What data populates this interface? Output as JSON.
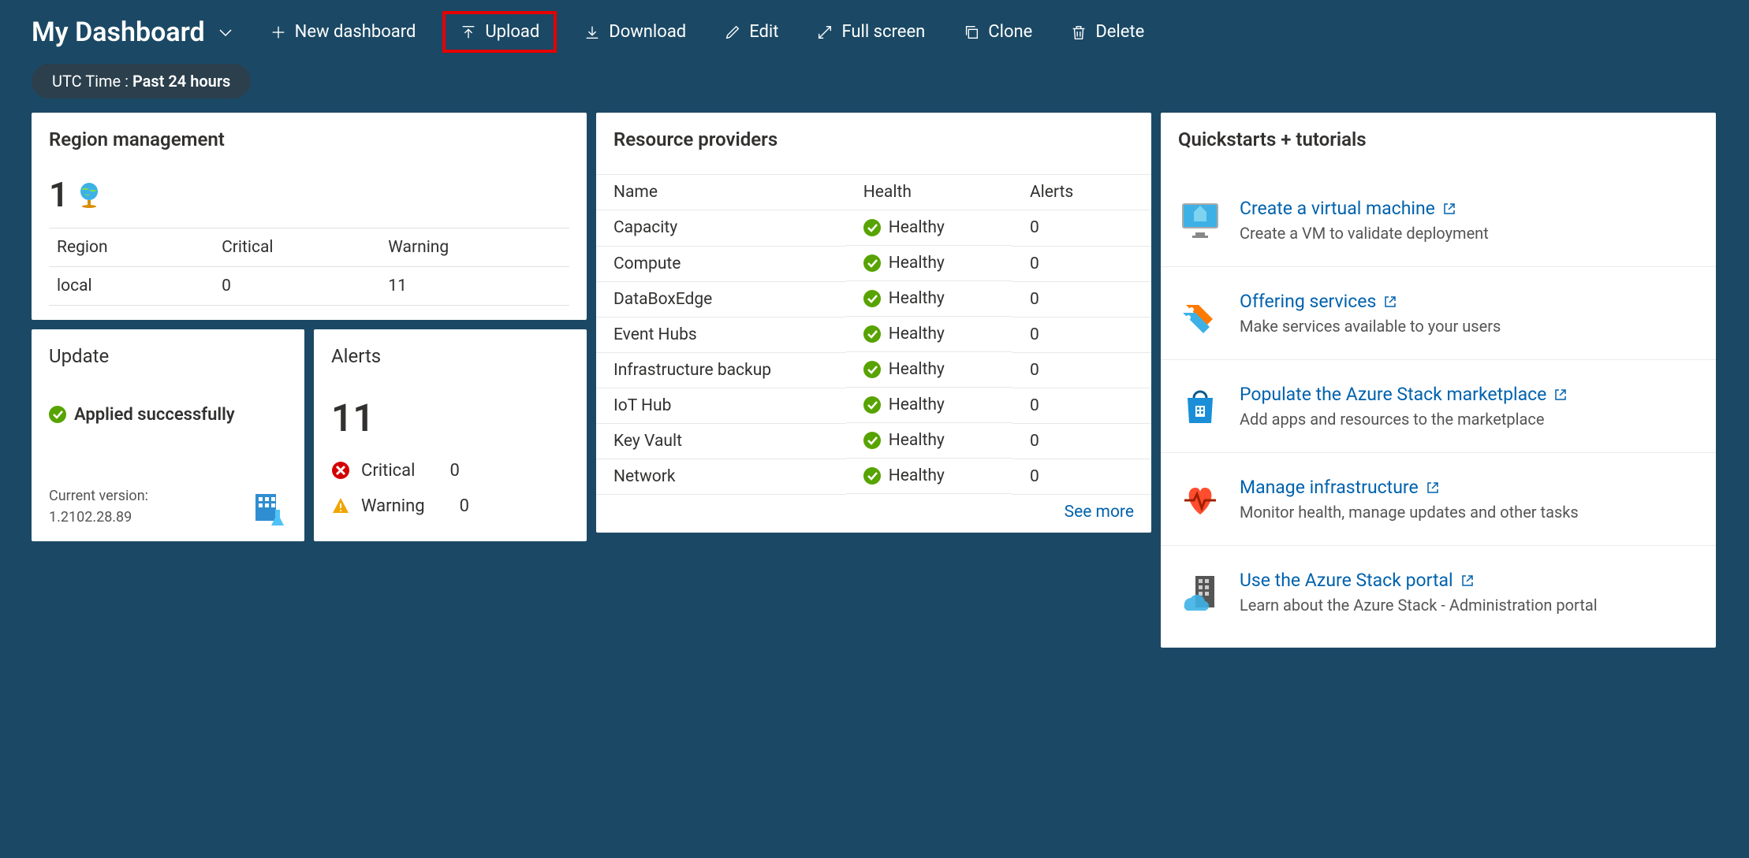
{
  "header": {
    "title": "My Dashboard",
    "buttons": {
      "new_dashboard": "New dashboard",
      "upload": "Upload",
      "download": "Download",
      "edit": "Edit",
      "full_screen": "Full screen",
      "clone": "Clone",
      "delete": "Delete"
    },
    "time_pill_prefix": "UTC Time : ",
    "time_pill_value": "Past 24 hours"
  },
  "region_mgmt": {
    "title": "Region management",
    "count": "1",
    "cols": {
      "region": "Region",
      "critical": "Critical",
      "warning": "Warning"
    },
    "rows": [
      {
        "region": "local",
        "critical": "0",
        "warning": "11"
      }
    ]
  },
  "update": {
    "title": "Update",
    "status": "Applied successfully",
    "version_label": "Current version:",
    "version": "1.2102.28.89"
  },
  "alerts": {
    "title": "Alerts",
    "count": "11",
    "rows": [
      {
        "icon": "critical",
        "label": "Critical",
        "value": "0"
      },
      {
        "icon": "warning",
        "label": "Warning",
        "value": "0"
      }
    ]
  },
  "rp": {
    "title": "Resource providers",
    "cols": {
      "name": "Name",
      "health": "Health",
      "alerts": "Alerts"
    },
    "rows": [
      {
        "name": "Capacity",
        "health": "Healthy",
        "alerts": "0"
      },
      {
        "name": "Compute",
        "health": "Healthy",
        "alerts": "0"
      },
      {
        "name": "DataBoxEdge",
        "health": "Healthy",
        "alerts": "0"
      },
      {
        "name": "Event Hubs",
        "health": "Healthy",
        "alerts": "0"
      },
      {
        "name": "Infrastructure backup",
        "health": "Healthy",
        "alerts": "0"
      },
      {
        "name": "IoT Hub",
        "health": "Healthy",
        "alerts": "0"
      },
      {
        "name": "Key Vault",
        "health": "Healthy",
        "alerts": "0"
      },
      {
        "name": "Network",
        "health": "Healthy",
        "alerts": "0"
      }
    ],
    "see_more": "See more"
  },
  "qs": {
    "title": "Quickstarts + tutorials",
    "items": [
      {
        "link": "Create a virtual machine",
        "desc": "Create a VM to validate deployment"
      },
      {
        "link": "Offering services",
        "desc": "Make services available to your users"
      },
      {
        "link": "Populate the Azure Stack marketplace",
        "desc": "Add apps and resources to the marketplace"
      },
      {
        "link": "Manage infrastructure",
        "desc": "Monitor health, manage updates and other tasks"
      },
      {
        "link": "Use the Azure Stack portal",
        "desc": "Learn about the Azure Stack - Administration portal"
      }
    ]
  }
}
